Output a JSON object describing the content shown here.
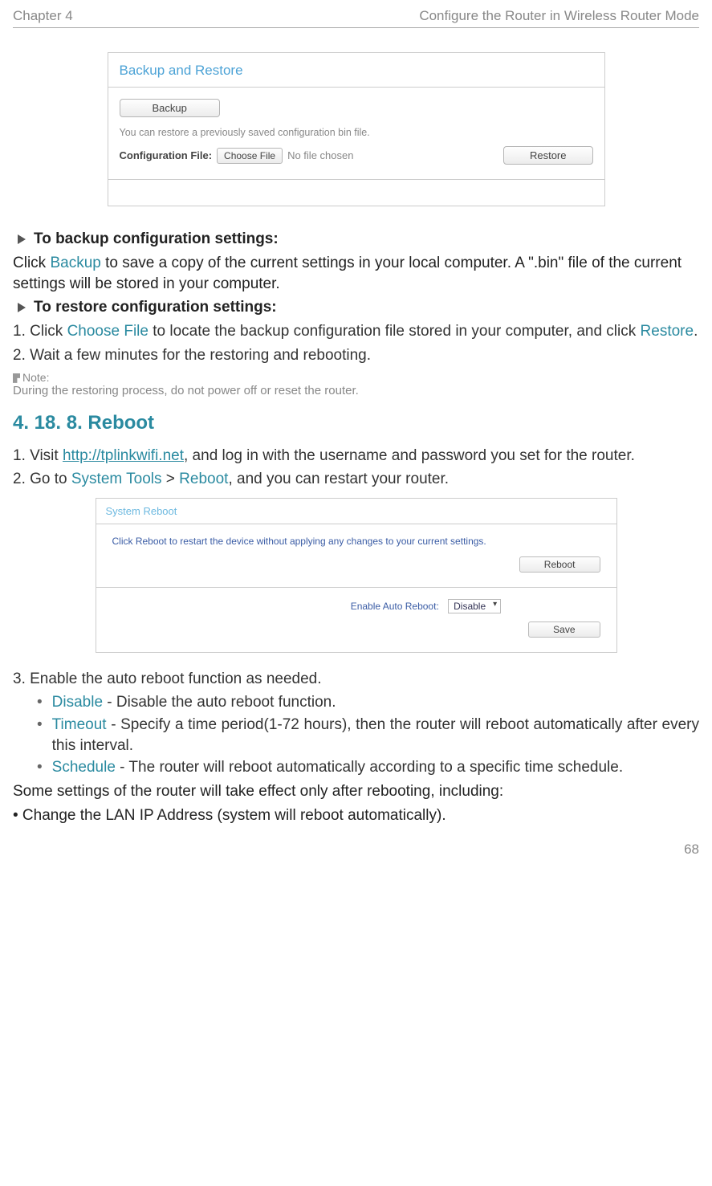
{
  "header": {
    "chapter": "Chapter 4",
    "title": "Configure the Router in Wireless Router Mode"
  },
  "screenshot1": {
    "title": "Backup and Restore",
    "backup_button": "Backup",
    "restore_desc": "You can restore a previously saved configuration bin file.",
    "config_file_label": "Configuration File:",
    "choose_file_button": "Choose File",
    "no_file_text": "No file chosen",
    "restore_button": "Restore"
  },
  "section_backup": {
    "heading": "To backup configuration settings:",
    "text_pre": "Click ",
    "text_link": "Backup",
    "text_post": " to save a copy of the current settings in your local computer. A \".bin\" file of the current settings will be stored in your computer."
  },
  "section_restore": {
    "heading": "To restore configuration settings:",
    "step1_pre": "1. Click ",
    "step1_link1": "Choose File",
    "step1_mid": " to locate the backup configuration file stored in your computer, and click ",
    "step1_link2": "Restore",
    "step1_post": ".",
    "step2": "2. Wait a few minutes for the restoring and rebooting.",
    "note_label": "Note:",
    "note_body": "During the restoring process, do not power off or reset the router."
  },
  "section_reboot": {
    "number_title": "4. 18. 8.   Reboot",
    "step1_pre": "1. Visit ",
    "step1_link": "http://tplinkwifi.net",
    "step1_post": ", and log in with the username and password you set for the router.",
    "step2_pre": "2. Go to ",
    "step2_link1": "System Tools",
    "step2_mid": " > ",
    "step2_link2": "Reboot",
    "step2_post": ", and you can restart your router."
  },
  "screenshot2": {
    "title": "System Reboot",
    "desc": "Click Reboot to restart the device without applying any changes to your current settings.",
    "reboot_button": "Reboot",
    "auto_label": "Enable Auto Reboot:",
    "auto_value": "Disable",
    "save_button": "Save"
  },
  "after_ss2": {
    "step3": "3. Enable the auto reboot function as needed.",
    "item1_link": "Disable",
    "item1_text": " - Disable the auto reboot function.",
    "item2_link": "Timeout",
    "item2_text": " - Specify a time period(1-72 hours), then the router will reboot automatically after every this interval.",
    "item3_link": "Schedule",
    "item3_text": " - The router will reboot automatically according to a specific time schedule.",
    "closing": "Some settings of the router will take effect only after rebooting, including:",
    "closing_bullet": "•  Change the LAN IP Address (system will reboot automatically)."
  },
  "page_number": "68"
}
